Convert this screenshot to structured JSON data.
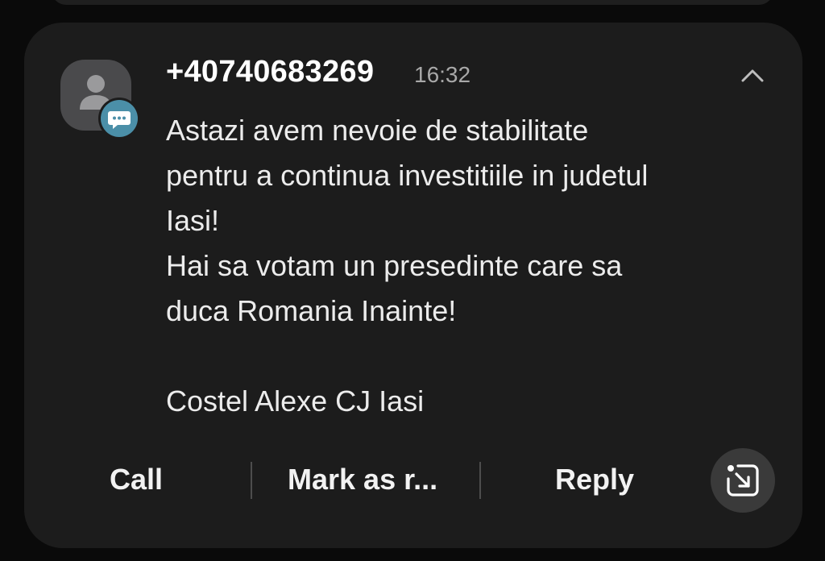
{
  "notification": {
    "sender": "+40740683269",
    "time": "16:32",
    "icons": {
      "avatar": "person-icon",
      "badge": "message-bubble-icon",
      "collapse": "chevron-up-icon",
      "expand": "open-in-app-icon"
    },
    "message_lines": [
      "Astazi avem nevoie de stabilitate",
      "pentru a continua investitiile in judetul",
      "Iasi!",
      "Hai sa votam un presedinte care sa",
      "duca Romania Inainte!",
      "",
      "Costel Alexe CJ Iasi"
    ],
    "actions": {
      "call": "Call",
      "mark_as_read": "Mark as r...",
      "reply": "Reply"
    },
    "colors": {
      "card_background": "#1c1c1c",
      "badge": "#4b8fa8",
      "avatar_background": "#4a4a4c"
    }
  }
}
